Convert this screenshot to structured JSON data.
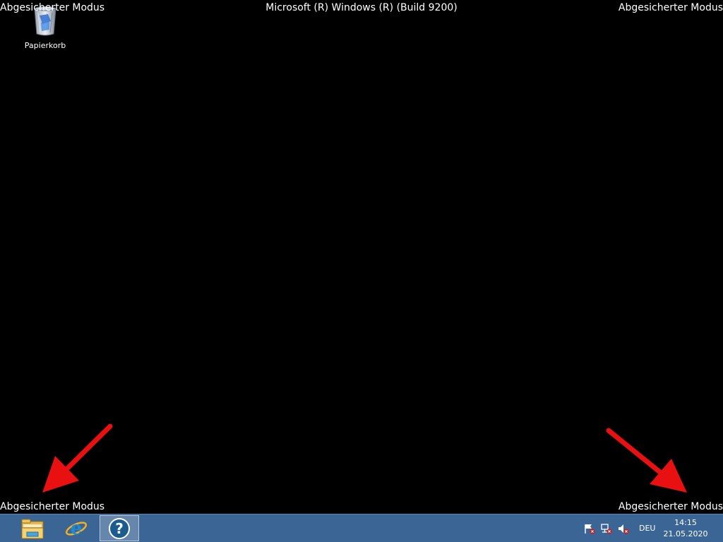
{
  "watermarks": {
    "top_left": "Abgesicherter Modus",
    "top_center": "Microsoft (R) Windows (R) (Build 9200)",
    "top_right": "Abgesicherter Modus",
    "bottom_left": "Abgesicherter Modus",
    "bottom_right": "Abgesicherter Modus"
  },
  "desktop": {
    "icons": [
      {
        "label": "Papierkorb",
        "icon": "recycle-bin-icon"
      }
    ]
  },
  "annotations": {
    "arrow_color": "#e81010"
  },
  "taskbar": {
    "background": "#3b6595",
    "pinned": [
      {
        "icon": "file-explorer-icon"
      },
      {
        "icon": "internet-explorer-icon"
      },
      {
        "icon": "help-icon",
        "active": true
      }
    ],
    "tray": {
      "icons": [
        "action-center-flag-icon",
        "network-icon",
        "volume-muted-icon"
      ],
      "language": "DEU",
      "time": "14:15",
      "date": "21.05.2020"
    }
  }
}
